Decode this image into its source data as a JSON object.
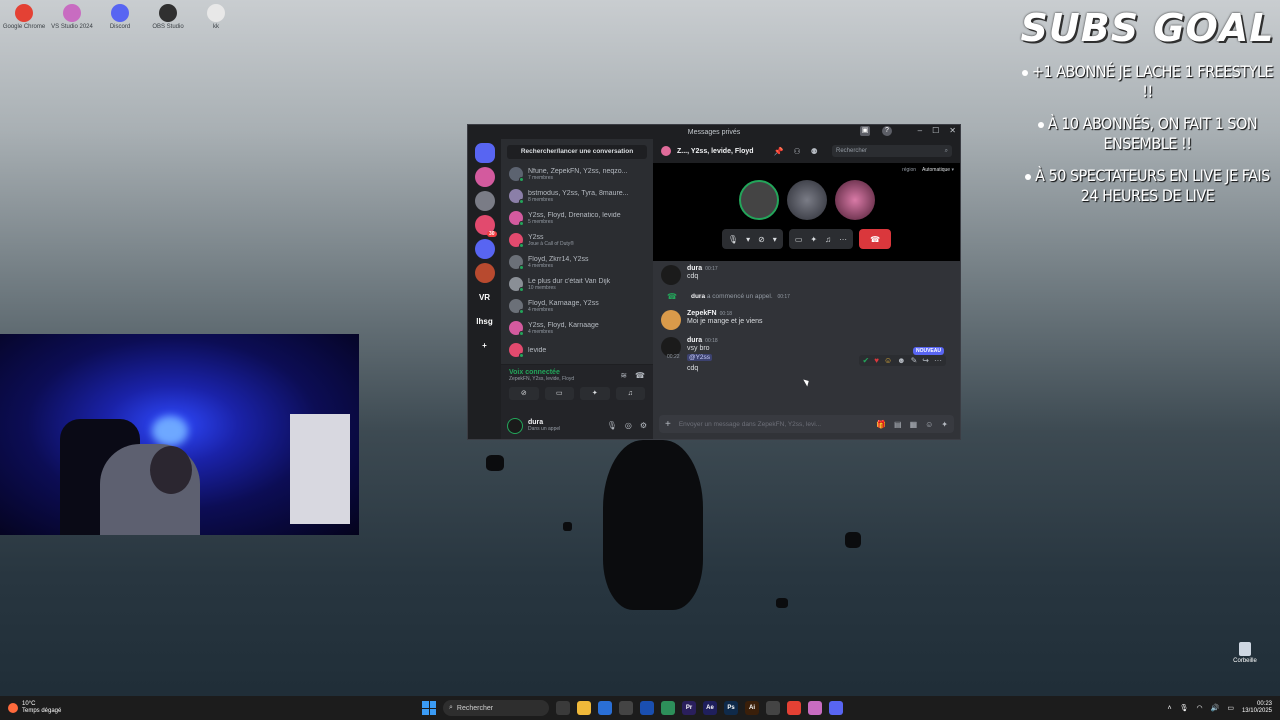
{
  "desktop": {
    "icons": [
      {
        "label": "Google Chrome",
        "color": "#e44134"
      },
      {
        "label": "VS Studio 2024",
        "color": "#c86cc1"
      },
      {
        "label": "Discord",
        "color": "#5865f2"
      },
      {
        "label": "OBS Studio",
        "color": "#303030"
      },
      {
        "label": "kk",
        "color": "#e8e8e8"
      }
    ],
    "recycle_bin": "Corbeille"
  },
  "overlay": {
    "title": "SUBS GOAL",
    "goals": [
      "+1 ABONNÉ JE LACHE 1 FREESTYLE !!",
      "À 10 ABONNÉS, ON FAIT 1 SON ENSEMBLE !!",
      "À 50 SPECTATEURS EN LIVE JE FAIS",
      "24 HEURES DE LIVE"
    ]
  },
  "discord": {
    "window_title": "Messages privés",
    "servers": [
      {
        "label": "",
        "type": "home"
      },
      {
        "label": "",
        "badge": "",
        "color": "#d35a9e"
      },
      {
        "label": "",
        "color": "#7a7c86"
      },
      {
        "label": "",
        "badge": "30",
        "color": "#e24a6e"
      },
      {
        "label": "",
        "color": "#5865f2"
      },
      {
        "label": "",
        "color": "#b84a2f"
      },
      {
        "label": "VR",
        "type": "text"
      },
      {
        "label": "lhsg",
        "type": "text"
      },
      {
        "label": "+",
        "type": "text"
      }
    ],
    "dm_search": "Rechercher/lancer une conversation",
    "dms": [
      {
        "name": "Nfune, ZepekFN, Y2ss, neqzo...",
        "sub": "7 membres",
        "color": "#5c6370"
      },
      {
        "name": "bstmodus, Y2ss, Tyra, 8maure...",
        "sub": "8 membres",
        "color": "#8b7fa8"
      },
      {
        "name": "Y2ss, Floyd, Drenatico, levide",
        "sub": "5 membres",
        "color": "#d35a9e"
      },
      {
        "name": "Y2ss",
        "sub": "Joue à Call of Duty®",
        "color": "#e24a6e"
      },
      {
        "name": "Floyd, Zkrr14, Y2ss",
        "sub": "4 membres",
        "color": "#6b7078"
      },
      {
        "name": "Le plus dur c'était Van Dijk",
        "sub": "10 membres",
        "color": "#8a8f96"
      },
      {
        "name": "Floyd, Karnaage, Y2ss",
        "sub": "4 membres",
        "color": "#6b7078"
      },
      {
        "name": "Y2ss, Floyd, Karnaage",
        "sub": "4 membres",
        "color": "#d35a9e"
      },
      {
        "name": "levide",
        "sub": "",
        "color": "#e24a6e"
      }
    ],
    "voice": {
      "title": "Voix connectée",
      "members": "ZepekFN, Y2ss, levide, Floyd"
    },
    "user": {
      "name": "dura",
      "status": "Dans un appel"
    },
    "chat": {
      "title": "Z..., Y2ss, levide, Floyd",
      "search_placeholder": "Rechercher",
      "region_label": "région",
      "region_value": "Automatique",
      "messages": [
        {
          "author": "dura",
          "time": "00:17",
          "text": "cdq",
          "avatar": "#1b1b1b"
        },
        {
          "author": "ZepekFN",
          "time": "00:18",
          "text": "Moi je mange et je viens",
          "avatar": "#d99a4a"
        },
        {
          "author": "dura",
          "time": "00:18",
          "text": "vsy bro",
          "avatar": "#1b1b1b"
        }
      ],
      "system": {
        "author": "dura",
        "text": "a commencé un appel.",
        "time": "00:17"
      },
      "extra_time": "00:22",
      "mention": "@Y2ss",
      "last_line": "cdq",
      "new_badge": "NOUVEAU",
      "input_placeholder": "Envoyer un message dans ZepekFN, Y2ss, levi..."
    }
  },
  "taskbar": {
    "weather_temp": "10°C",
    "weather_text": "Temps dégagé",
    "search": "Rechercher",
    "apps": [
      {
        "label": "",
        "color": "#3a3a3a"
      },
      {
        "label": "",
        "color": "#f0b93a"
      },
      {
        "label": "",
        "color": "#2a6fd6"
      },
      {
        "label": "",
        "color": "#444"
      },
      {
        "label": "",
        "color": "#1a4fb0"
      },
      {
        "label": "",
        "color": "#2d8f5a"
      },
      {
        "label": "Pr",
        "color": "#2a1f5c"
      },
      {
        "label": "Ae",
        "color": "#1f1f5c"
      },
      {
        "label": "Ps",
        "color": "#0f2a4a"
      },
      {
        "label": "Ai",
        "color": "#3a1f0a"
      },
      {
        "label": "",
        "color": "#444"
      },
      {
        "label": "",
        "color": "#e44134"
      },
      {
        "label": "",
        "color": "#c86cc1"
      },
      {
        "label": "",
        "color": "#5865f2"
      }
    ],
    "time": "00:23",
    "date": "13/10/2025"
  }
}
